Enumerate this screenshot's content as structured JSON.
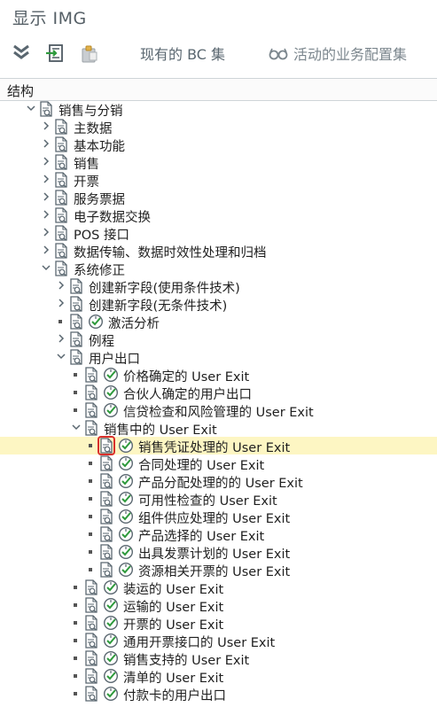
{
  "title": "显示 IMG",
  "toolbar": {
    "current_bc_label": "现有的 BC 集",
    "active_config_label": "活动的业务配置集"
  },
  "section_label": "结构",
  "tree": [
    {
      "id": "r0",
      "label": "销售与分销",
      "level": 0,
      "node": "expanded",
      "activity": false
    },
    {
      "id": "r1",
      "label": "主数据",
      "level": 1,
      "node": "collapsed",
      "activity": false
    },
    {
      "id": "r2",
      "label": "基本功能",
      "level": 1,
      "node": "collapsed",
      "activity": false
    },
    {
      "id": "r3",
      "label": "销售",
      "level": 1,
      "node": "collapsed",
      "activity": false
    },
    {
      "id": "r4",
      "label": "开票",
      "level": 1,
      "node": "collapsed",
      "activity": false
    },
    {
      "id": "r5",
      "label": "服务票据",
      "level": 1,
      "node": "collapsed",
      "activity": false
    },
    {
      "id": "r6",
      "label": "电子数据交换",
      "level": 1,
      "node": "collapsed",
      "activity": false
    },
    {
      "id": "r7",
      "label": "POS 接口",
      "level": 1,
      "node": "collapsed",
      "activity": false
    },
    {
      "id": "r8",
      "label": "数据传输、数据时效性处理和归档",
      "level": 1,
      "node": "collapsed",
      "activity": false
    },
    {
      "id": "r9",
      "label": "系统修正",
      "level": 1,
      "node": "expanded",
      "activity": false
    },
    {
      "id": "r10",
      "label": "创建新字段(使用条件技术)",
      "level": 2,
      "node": "collapsed",
      "activity": false
    },
    {
      "id": "r11",
      "label": "创建新字段(无条件技术)",
      "level": 2,
      "node": "collapsed",
      "activity": false
    },
    {
      "id": "r12",
      "label": "激活分析",
      "level": 2,
      "node": "leaf",
      "activity": true
    },
    {
      "id": "r13",
      "label": "例程",
      "level": 2,
      "node": "collapsed",
      "activity": false
    },
    {
      "id": "r14",
      "label": "用户出口",
      "level": 2,
      "node": "expanded",
      "activity": false
    },
    {
      "id": "r15",
      "label": "价格确定的 User Exit",
      "level": 3,
      "node": "leaf",
      "activity": true
    },
    {
      "id": "r16",
      "label": "合伙人确定的用户出口",
      "level": 3,
      "node": "leaf",
      "activity": true
    },
    {
      "id": "r17",
      "label": "信贷检查和风险管理的 User Exit",
      "level": 3,
      "node": "leaf",
      "activity": true
    },
    {
      "id": "r18",
      "label": "销售中的 User Exit",
      "level": 3,
      "node": "expanded",
      "activity": false
    },
    {
      "id": "r19",
      "label": "销售凭证处理的 User Exit",
      "level": 4,
      "node": "leaf",
      "activity": true,
      "selected": true
    },
    {
      "id": "r20",
      "label": "合同处理的 User Exit",
      "level": 4,
      "node": "leaf",
      "activity": true
    },
    {
      "id": "r21",
      "label": "产品分配处理的的 User Exit",
      "level": 4,
      "node": "leaf",
      "activity": true
    },
    {
      "id": "r22",
      "label": "可用性检查的 User Exit",
      "level": 4,
      "node": "leaf",
      "activity": true
    },
    {
      "id": "r23",
      "label": "组件供应处理的 User Exit",
      "level": 4,
      "node": "leaf",
      "activity": true
    },
    {
      "id": "r24",
      "label": "产品选择的 User Exit",
      "level": 4,
      "node": "leaf",
      "activity": true
    },
    {
      "id": "r25",
      "label": "出具发票计划的 User Exit",
      "level": 4,
      "node": "leaf",
      "activity": true
    },
    {
      "id": "r26",
      "label": "资源相关开票的 User Exit",
      "level": 4,
      "node": "leaf",
      "activity": true
    },
    {
      "id": "r27",
      "label": "装运的 User Exit",
      "level": 3,
      "node": "leaf",
      "activity": true
    },
    {
      "id": "r28",
      "label": "运输的 User Exit",
      "level": 3,
      "node": "leaf",
      "activity": true
    },
    {
      "id": "r29",
      "label": "开票的 User Exit",
      "level": 3,
      "node": "leaf",
      "activity": true
    },
    {
      "id": "r30",
      "label": "通用开票接口的 User Exit",
      "level": 3,
      "node": "leaf",
      "activity": true
    },
    {
      "id": "r31",
      "label": "销售支持的 User Exit",
      "level": 3,
      "node": "leaf",
      "activity": true
    },
    {
      "id": "r32",
      "label": "清单的 User Exit",
      "level": 3,
      "node": "leaf",
      "activity": true
    },
    {
      "id": "r33",
      "label": "付款卡的用户出口",
      "level": 3,
      "node": "leaf",
      "activity": true
    }
  ],
  "colors": {
    "selected_row": "#fdf6c3",
    "selection_box": "#d9302c",
    "check_green": "#2e9a3c",
    "icon_grey": "#5a6770"
  }
}
